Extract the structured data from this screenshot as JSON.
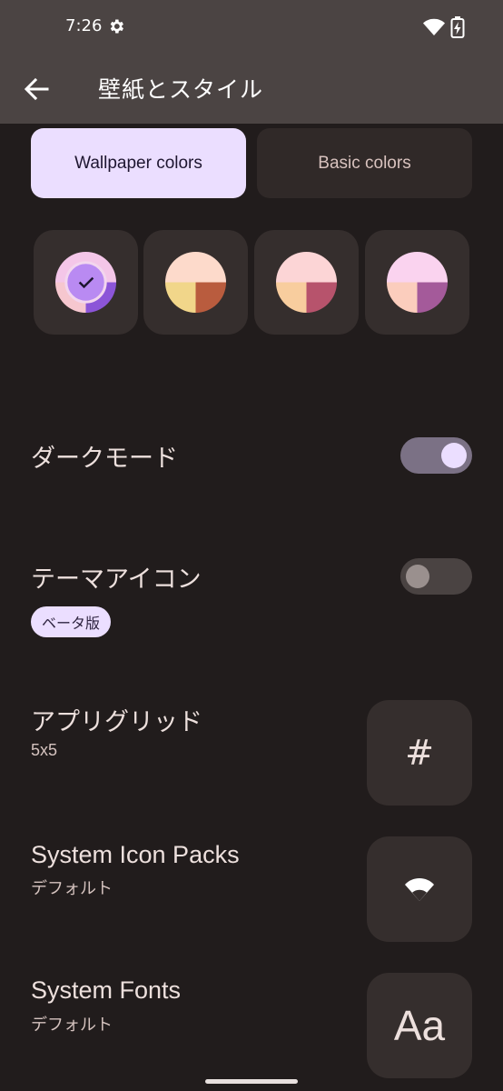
{
  "status_bar": {
    "time": "7:26",
    "icons": [
      "gear-icon",
      "wifi-icon",
      "battery-charging-icon"
    ]
  },
  "app_bar": {
    "back_icon": "arrow-back-icon",
    "title": "壁紙とスタイル"
  },
  "color_source_tabs": {
    "wallpaper": "Wallpaper colors",
    "basic": "Basic colors",
    "selected": "wallpaper"
  },
  "color_options": [
    {
      "selected": true,
      "top": "#f4c6e8",
      "bottom_left": "#f6c7cf",
      "bottom_right": "#8c55d8",
      "center": "#b98af2"
    },
    {
      "selected": false,
      "top": "#fddacb",
      "bottom_left": "#f1d68a",
      "bottom_right": "#b95c3e"
    },
    {
      "selected": false,
      "top": "#fcd5d6",
      "bottom_left": "#f8cd9e",
      "bottom_right": "#b7536c"
    },
    {
      "selected": false,
      "top": "#fad3ef",
      "bottom_left": "#fbcdbd",
      "bottom_right": "#a45a9a"
    }
  ],
  "dark_mode": {
    "label": "ダークモード",
    "on": true
  },
  "themed_icons": {
    "label": "テーマアイコン",
    "badge": "ベータ版",
    "on": false
  },
  "app_grid": {
    "label": "アプリグリッド",
    "value": "5x5",
    "preview": "#"
  },
  "icon_packs": {
    "label": "System Icon Packs",
    "value": "デフォルト",
    "preview_icon": "wifi-icon"
  },
  "fonts": {
    "label": "System Fonts",
    "value": "デフォルト",
    "preview": "Aa"
  },
  "colors": {
    "background": "#211c1c",
    "app_bar": "#4b4443",
    "accent": "#ebdeff",
    "card": "#352e2d"
  }
}
